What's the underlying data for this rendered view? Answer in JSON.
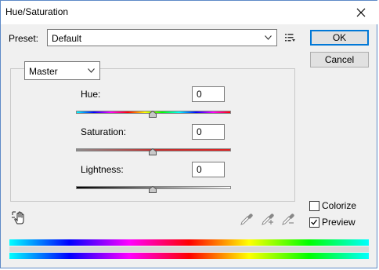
{
  "window": {
    "title": "Hue/Saturation"
  },
  "preset": {
    "label": "Preset:",
    "value": "Default"
  },
  "buttons": {
    "ok": "OK",
    "cancel": "Cancel"
  },
  "channel": {
    "value": "Master"
  },
  "adjustments": {
    "hue": {
      "label": "Hue:",
      "value": "0"
    },
    "saturation": {
      "label": "Saturation:",
      "value": "0"
    },
    "lightness": {
      "label": "Lightness:",
      "value": "0"
    }
  },
  "options": {
    "colorize": {
      "label": "Colorize",
      "checked": false
    },
    "preview": {
      "label": "Preview",
      "checked": true
    }
  },
  "colors": {
    "accent": "#0078d7",
    "face": "#f0f0f0"
  },
  "icons": [
    "close-icon",
    "preset-options-icon",
    "chevron-down-icon",
    "targeted-adjustment-hand-icon",
    "eyedropper-icon",
    "add-to-sample-eyedropper-icon",
    "subtract-from-sample-eyedropper-icon",
    "check-icon"
  ]
}
